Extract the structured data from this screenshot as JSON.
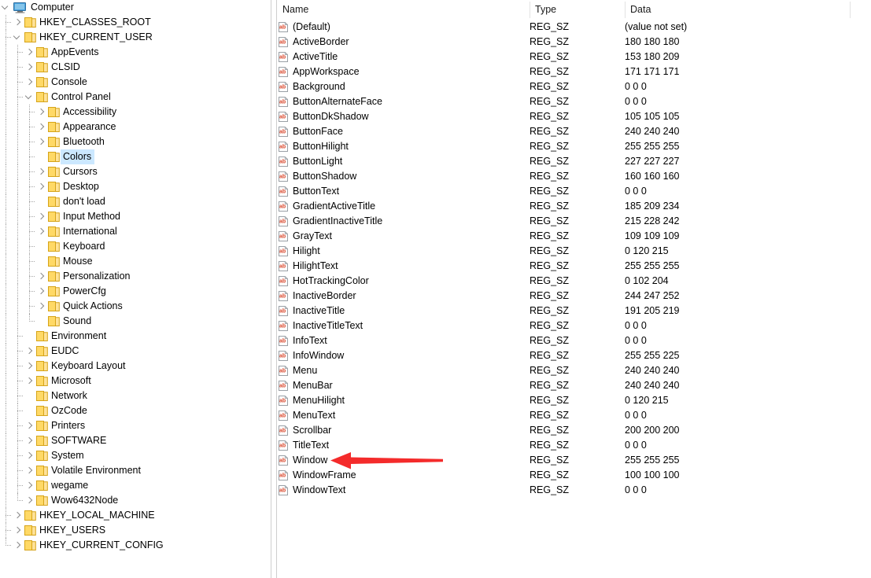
{
  "window": {
    "app": "registry-editor",
    "selected_key": "Colors"
  },
  "tree": {
    "root_label": "Computer",
    "root_icon": "computer-monitor-icon",
    "items": [
      {
        "label": "Computer",
        "depth": 0,
        "chevron": "open",
        "icon": "computer-monitor-icon",
        "selected": false
      },
      {
        "label": "HKEY_CLASSES_ROOT",
        "depth": 1,
        "chevron": "closed",
        "icon": "folder-icon",
        "selected": false
      },
      {
        "label": "HKEY_CURRENT_USER",
        "depth": 1,
        "chevron": "open",
        "icon": "folder-icon",
        "selected": false
      },
      {
        "label": "AppEvents",
        "depth": 2,
        "chevron": "closed",
        "icon": "folder-icon",
        "selected": false
      },
      {
        "label": "CLSID",
        "depth": 2,
        "chevron": "closed",
        "icon": "folder-icon",
        "selected": false
      },
      {
        "label": "Console",
        "depth": 2,
        "chevron": "closed",
        "icon": "folder-icon",
        "selected": false
      },
      {
        "label": "Control Panel",
        "depth": 2,
        "chevron": "open",
        "icon": "folder-icon",
        "selected": false
      },
      {
        "label": "Accessibility",
        "depth": 3,
        "chevron": "closed",
        "icon": "folder-icon",
        "selected": false
      },
      {
        "label": "Appearance",
        "depth": 3,
        "chevron": "closed",
        "icon": "folder-icon",
        "selected": false
      },
      {
        "label": "Bluetooth",
        "depth": 3,
        "chevron": "closed",
        "icon": "folder-icon",
        "selected": false
      },
      {
        "label": "Colors",
        "depth": 3,
        "chevron": "none",
        "icon": "folder-icon",
        "selected": true
      },
      {
        "label": "Cursors",
        "depth": 3,
        "chevron": "closed",
        "icon": "folder-icon",
        "selected": false
      },
      {
        "label": "Desktop",
        "depth": 3,
        "chevron": "closed",
        "icon": "folder-icon",
        "selected": false
      },
      {
        "label": "don't load",
        "depth": 3,
        "chevron": "none",
        "icon": "folder-icon",
        "selected": false
      },
      {
        "label": "Input Method",
        "depth": 3,
        "chevron": "closed",
        "icon": "folder-icon",
        "selected": false
      },
      {
        "label": "International",
        "depth": 3,
        "chevron": "closed",
        "icon": "folder-icon",
        "selected": false
      },
      {
        "label": "Keyboard",
        "depth": 3,
        "chevron": "none",
        "icon": "folder-icon",
        "selected": false
      },
      {
        "label": "Mouse",
        "depth": 3,
        "chevron": "none",
        "icon": "folder-icon",
        "selected": false
      },
      {
        "label": "Personalization",
        "depth": 3,
        "chevron": "closed",
        "icon": "folder-icon",
        "selected": false
      },
      {
        "label": "PowerCfg",
        "depth": 3,
        "chevron": "closed",
        "icon": "folder-icon",
        "selected": false
      },
      {
        "label": "Quick Actions",
        "depth": 3,
        "chevron": "closed",
        "icon": "folder-icon",
        "selected": false
      },
      {
        "label": "Sound",
        "depth": 3,
        "chevron": "none",
        "icon": "folder-icon",
        "selected": false
      },
      {
        "label": "Environment",
        "depth": 2,
        "chevron": "none",
        "icon": "folder-icon",
        "selected": false
      },
      {
        "label": "EUDC",
        "depth": 2,
        "chevron": "closed",
        "icon": "folder-icon",
        "selected": false
      },
      {
        "label": "Keyboard Layout",
        "depth": 2,
        "chevron": "closed",
        "icon": "folder-icon",
        "selected": false
      },
      {
        "label": "Microsoft",
        "depth": 2,
        "chevron": "closed",
        "icon": "folder-icon",
        "selected": false
      },
      {
        "label": "Network",
        "depth": 2,
        "chevron": "none",
        "icon": "folder-icon",
        "selected": false
      },
      {
        "label": "OzCode",
        "depth": 2,
        "chevron": "none",
        "icon": "folder-icon",
        "selected": false
      },
      {
        "label": "Printers",
        "depth": 2,
        "chevron": "closed",
        "icon": "folder-icon",
        "selected": false
      },
      {
        "label": "SOFTWARE",
        "depth": 2,
        "chevron": "closed",
        "icon": "folder-icon",
        "selected": false
      },
      {
        "label": "System",
        "depth": 2,
        "chevron": "closed",
        "icon": "folder-icon",
        "selected": false
      },
      {
        "label": "Volatile Environment",
        "depth": 2,
        "chevron": "closed",
        "icon": "folder-icon",
        "selected": false
      },
      {
        "label": "wegame",
        "depth": 2,
        "chevron": "closed",
        "icon": "folder-icon",
        "selected": false
      },
      {
        "label": "Wow6432Node",
        "depth": 2,
        "chevron": "closed",
        "icon": "folder-icon",
        "selected": false
      },
      {
        "label": "HKEY_LOCAL_MACHINE",
        "depth": 1,
        "chevron": "closed",
        "icon": "folder-icon",
        "selected": false
      },
      {
        "label": "HKEY_USERS",
        "depth": 1,
        "chevron": "closed",
        "icon": "folder-icon",
        "selected": false
      },
      {
        "label": "HKEY_CURRENT_CONFIG",
        "depth": 1,
        "chevron": "closed",
        "icon": "folder-icon",
        "selected": false
      }
    ]
  },
  "list": {
    "columns": [
      {
        "key": "name",
        "label": "Name"
      },
      {
        "key": "type",
        "label": "Type"
      },
      {
        "key": "data",
        "label": "Data"
      }
    ],
    "value_icon": "string-value-ab-icon",
    "rows": [
      {
        "name": "(Default)",
        "type": "REG_SZ",
        "data": "(value not set)"
      },
      {
        "name": "ActiveBorder",
        "type": "REG_SZ",
        "data": "180 180 180"
      },
      {
        "name": "ActiveTitle",
        "type": "REG_SZ",
        "data": "153 180 209"
      },
      {
        "name": "AppWorkspace",
        "type": "REG_SZ",
        "data": "171 171 171"
      },
      {
        "name": "Background",
        "type": "REG_SZ",
        "data": "0 0 0"
      },
      {
        "name": "ButtonAlternateFace",
        "type": "REG_SZ",
        "data": "0 0 0"
      },
      {
        "name": "ButtonDkShadow",
        "type": "REG_SZ",
        "data": "105 105 105"
      },
      {
        "name": "ButtonFace",
        "type": "REG_SZ",
        "data": "240 240 240"
      },
      {
        "name": "ButtonHilight",
        "type": "REG_SZ",
        "data": "255 255 255"
      },
      {
        "name": "ButtonLight",
        "type": "REG_SZ",
        "data": "227 227 227"
      },
      {
        "name": "ButtonShadow",
        "type": "REG_SZ",
        "data": "160 160 160"
      },
      {
        "name": "ButtonText",
        "type": "REG_SZ",
        "data": "0 0 0"
      },
      {
        "name": "GradientActiveTitle",
        "type": "REG_SZ",
        "data": "185 209 234"
      },
      {
        "name": "GradientInactiveTitle",
        "type": "REG_SZ",
        "data": "215 228 242"
      },
      {
        "name": "GrayText",
        "type": "REG_SZ",
        "data": "109 109 109"
      },
      {
        "name": "Hilight",
        "type": "REG_SZ",
        "data": "0 120 215"
      },
      {
        "name": "HilightText",
        "type": "REG_SZ",
        "data": "255 255 255"
      },
      {
        "name": "HotTrackingColor",
        "type": "REG_SZ",
        "data": "0 102 204"
      },
      {
        "name": "InactiveBorder",
        "type": "REG_SZ",
        "data": "244 247 252"
      },
      {
        "name": "InactiveTitle",
        "type": "REG_SZ",
        "data": "191 205 219"
      },
      {
        "name": "InactiveTitleText",
        "type": "REG_SZ",
        "data": "0 0 0"
      },
      {
        "name": "InfoText",
        "type": "REG_SZ",
        "data": "0 0 0"
      },
      {
        "name": "InfoWindow",
        "type": "REG_SZ",
        "data": "255 255 225"
      },
      {
        "name": "Menu",
        "type": "REG_SZ",
        "data": "240 240 240"
      },
      {
        "name": "MenuBar",
        "type": "REG_SZ",
        "data": "240 240 240"
      },
      {
        "name": "MenuHilight",
        "type": "REG_SZ",
        "data": "0 120 215"
      },
      {
        "name": "MenuText",
        "type": "REG_SZ",
        "data": "0 0 0"
      },
      {
        "name": "Scrollbar",
        "type": "REG_SZ",
        "data": "200 200 200"
      },
      {
        "name": "TitleText",
        "type": "REG_SZ",
        "data": "0 0 0"
      },
      {
        "name": "Window",
        "type": "REG_SZ",
        "data": "255 255 255"
      },
      {
        "name": "WindowFrame",
        "type": "REG_SZ",
        "data": "100 100 100"
      },
      {
        "name": "WindowText",
        "type": "REG_SZ",
        "data": "0 0 0"
      }
    ]
  },
  "annotation": {
    "type": "arrow",
    "icon": "red-arrow-left-icon",
    "color": "#f42b2b",
    "points_to": "Window"
  }
}
